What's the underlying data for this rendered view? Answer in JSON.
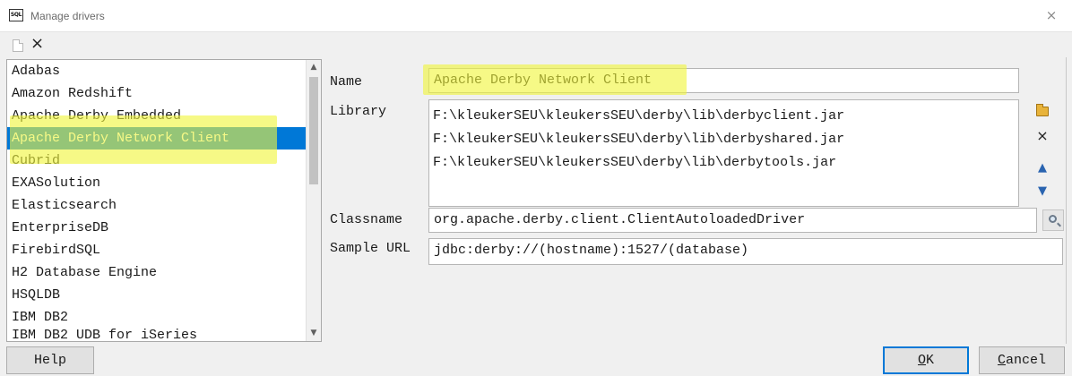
{
  "window": {
    "title": "Manage drivers",
    "app_icon_text": "SQL",
    "close_glyph": "×"
  },
  "toolbar": {
    "new_icon": "new-document-icon",
    "delete_glyph": "×"
  },
  "drivers": [
    "Adabas",
    "Amazon Redshift",
    "Apache Derby Embedded",
    "Apache Derby Network Client",
    "Cubrid",
    "EXASolution",
    "Elasticsearch",
    "EnterpriseDB",
    "FirebirdSQL",
    "H2 Database Engine",
    "HSQLDB",
    "IBM DB2",
    "IBM DB2 UDB for iSeries"
  ],
  "selected_driver": "Apache Derby Network Client",
  "form": {
    "name_label": "Name",
    "name_value": "Apache Derby Network Client",
    "library_label": "Library",
    "libraries": [
      "F:\\kleukerSEU\\kleukersSEU\\derby\\lib\\derbyclient.jar",
      "F:\\kleukerSEU\\kleukersSEU\\derby\\lib\\derbyshared.jar",
      "F:\\kleukerSEU\\kleukersSEU\\derby\\lib\\derbytools.jar"
    ],
    "classname_label": "Classname",
    "classname_value": "org.apache.derby.client.ClientAutoloadedDriver",
    "sample_url_label": "Sample URL",
    "sample_url_value": "jdbc:derby://(hostname):1527/(database)"
  },
  "library_buttons": {
    "add_icon": "open-folder-icon",
    "remove_glyph": "×",
    "up_glyph": "▲",
    "down_glyph": "▼"
  },
  "scrollbar": {
    "up_glyph": "▲",
    "down_glyph": "▼"
  },
  "buttons": {
    "help": "Help",
    "ok_mnemonic": "O",
    "ok_rest": "K",
    "cancel_mnemonic": "C",
    "cancel_rest": "ancel"
  },
  "highlight_color": "#f0f53c",
  "selection_color": "#0078d7"
}
